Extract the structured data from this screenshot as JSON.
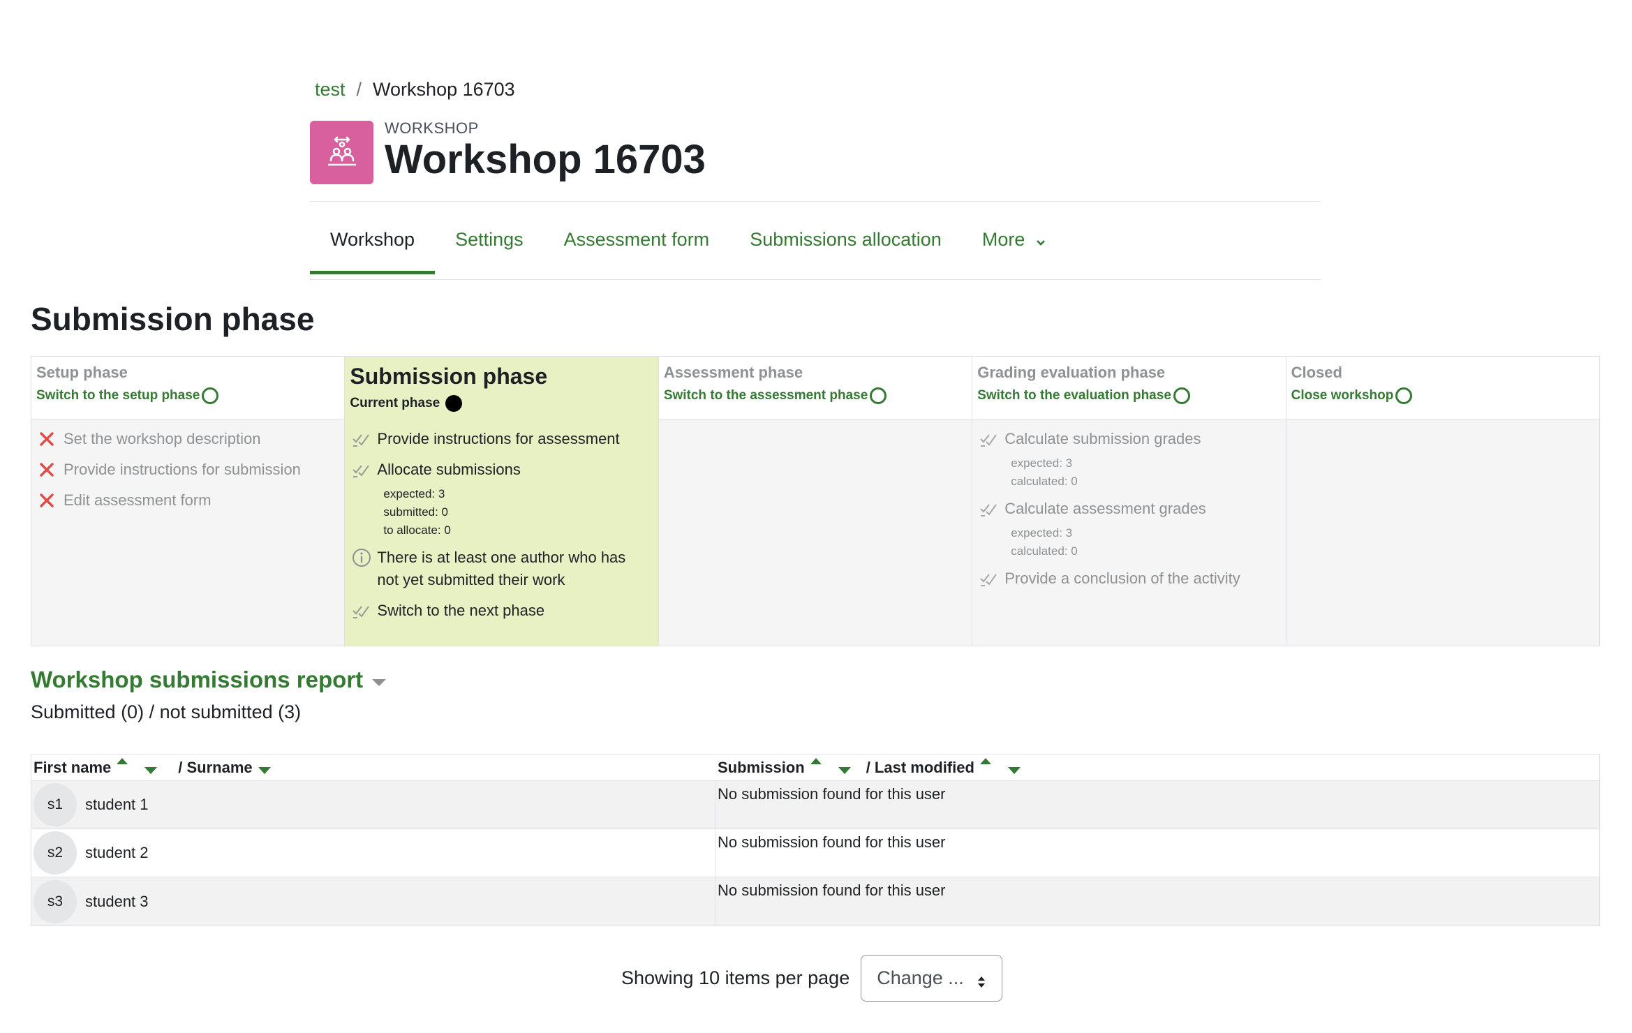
{
  "breadcrumb": {
    "course": "test",
    "separator": "/",
    "current": "Workshop 16703"
  },
  "header": {
    "kind": "WORKSHOP",
    "title": "Workshop 16703",
    "icon": "workshop-icon",
    "icon_color": "#d8609f"
  },
  "tabs": [
    {
      "label": "Workshop",
      "active": true
    },
    {
      "label": "Settings"
    },
    {
      "label": "Assessment form"
    },
    {
      "label": "Submissions allocation"
    },
    {
      "label": "More"
    }
  ],
  "page_heading": "Submission phase",
  "planner": {
    "setup": {
      "title": "Setup phase",
      "switch": "Switch to the setup phase",
      "tasks": [
        "Set the workshop description",
        "Provide instructions for submission",
        "Edit assessment form"
      ]
    },
    "submission": {
      "title": "Submission phase",
      "current": "Current phase",
      "tasks": {
        "instructions": "Provide instructions for assessment",
        "allocate": "Allocate submissions",
        "allocate_details": [
          "expected: 3",
          "submitted: 0",
          "to allocate: 0"
        ],
        "info_line1": "There is at least one author who has",
        "info_line2": "not yet submitted their work",
        "next": "Switch to the next phase"
      }
    },
    "assessment": {
      "title": "Assessment phase",
      "switch": "Switch to the assessment phase"
    },
    "evaluation": {
      "title": "Grading evaluation phase",
      "switch": "Switch to the evaluation phase",
      "tasks": {
        "calc_sub": "Calculate submission grades",
        "calc_sub_details": [
          "expected: 3",
          "calculated: 0"
        ],
        "calc_ass": "Calculate assessment grades",
        "calc_ass_details": [
          "expected: 3",
          "calculated: 0"
        ],
        "conclusion": "Provide a conclusion of the activity"
      }
    },
    "closed": {
      "title": "Closed",
      "switch": "Close workshop"
    },
    "colors": {
      "current_bg": "#e7f1c3",
      "accent": "#357a32",
      "fail": "#e14b46"
    }
  },
  "report": {
    "title": "Workshop submissions report",
    "summary": "Submitted (0) / not submitted (3)",
    "headers": {
      "first_name": "First name",
      "surname": "/ Surname",
      "submission": "Submission",
      "last_modified": "/ Last modified"
    },
    "rows": [
      {
        "initials": "s1",
        "name": "student 1",
        "submission": "No submission found for this user"
      },
      {
        "initials": "s2",
        "name": "student 2",
        "submission": "No submission found for this user"
      },
      {
        "initials": "s3",
        "name": "student 3",
        "submission": "No submission found for this user"
      }
    ]
  },
  "paging": {
    "label": "Showing 10 items per page",
    "select_value": "Change ..."
  }
}
